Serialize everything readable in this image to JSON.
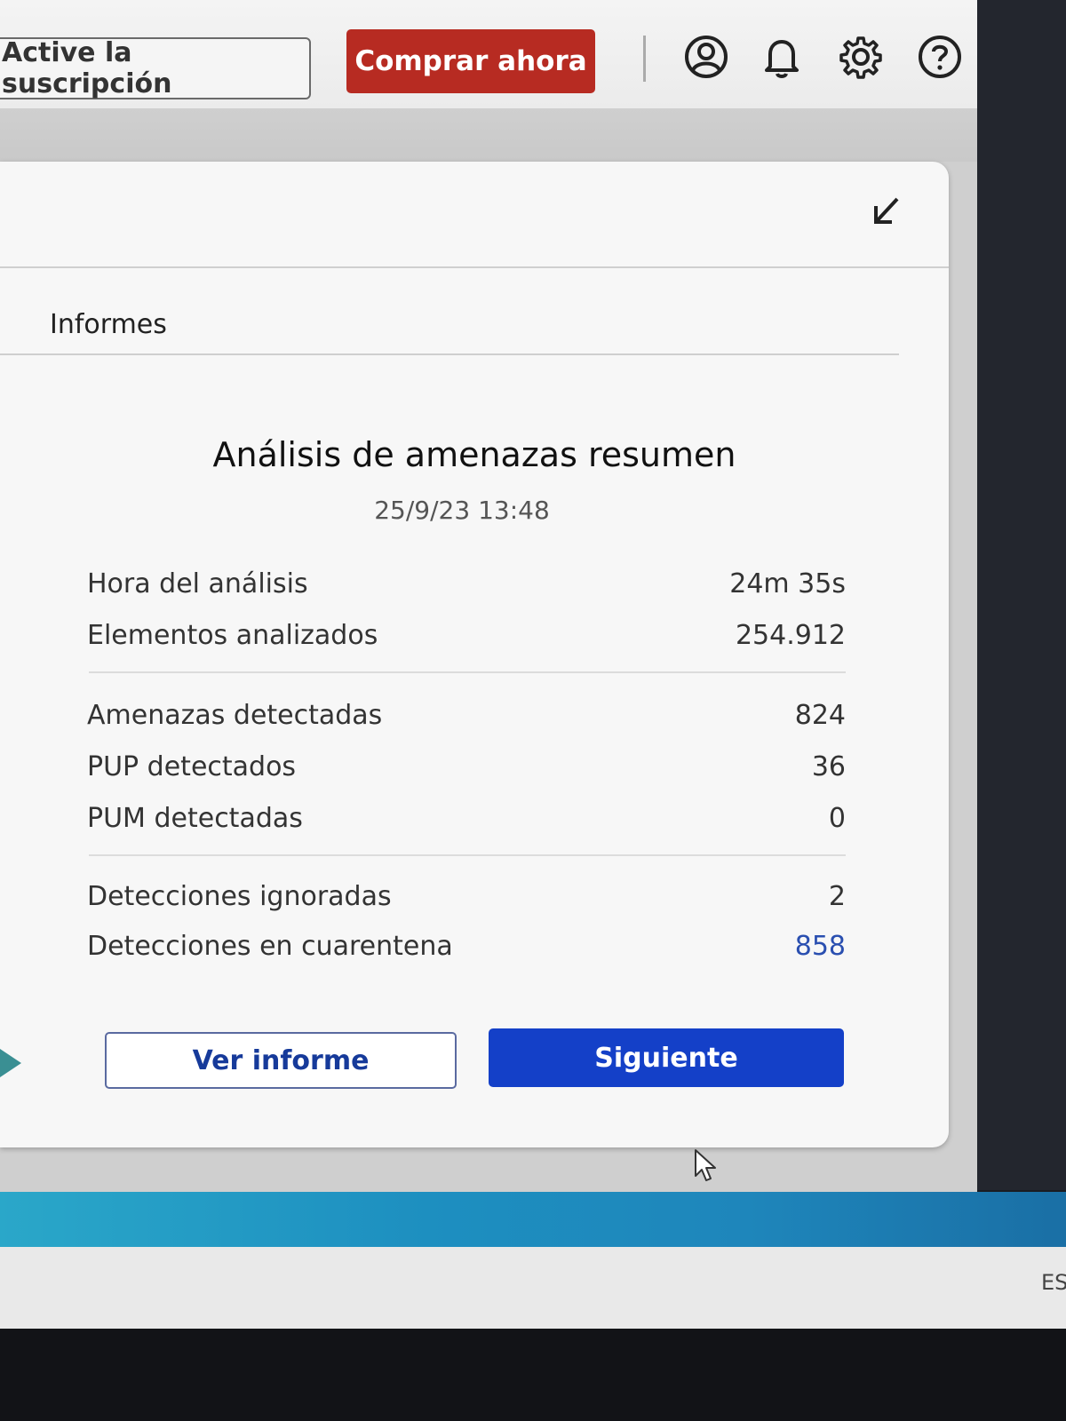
{
  "header": {
    "subscription_label": "Active la suscripción",
    "buy_label": "Comprar ahora",
    "icons": [
      "account-icon",
      "bell-icon",
      "gear-icon",
      "help-icon"
    ]
  },
  "panel": {
    "section_title": "Informes",
    "summary_title": "Análisis de amenazas resumen",
    "summary_date": "25/9/23 13:48",
    "stats": [
      {
        "label": "Hora del análisis",
        "value": "24m 35s"
      },
      {
        "label": "Elementos analizados",
        "value": "254.912"
      },
      {
        "label": "Amenazas detectadas",
        "value": "824"
      },
      {
        "label": "PUP detectados",
        "value": "36"
      },
      {
        "label": "PUM detectadas",
        "value": "0"
      },
      {
        "label": "Detecciones ignoradas",
        "value": "2"
      },
      {
        "label": "Detecciones en cuarentena",
        "value": "858"
      }
    ],
    "report_button": "Ver informe",
    "next_button": "Siguiente"
  },
  "taskbar": {
    "language": "ES"
  },
  "colors": {
    "buy_button": "#b72b22",
    "next_button": "#1440c8",
    "quarantine_value": "#2a4fb0"
  }
}
